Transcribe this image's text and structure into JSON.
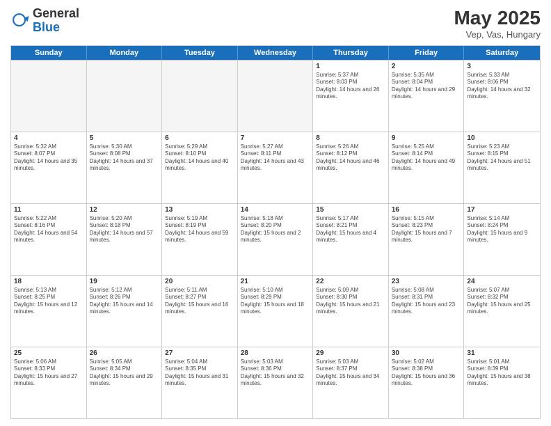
{
  "logo": {
    "general": "General",
    "blue": "Blue"
  },
  "header": {
    "title": "May 2025",
    "subtitle": "Vep, Vas, Hungary"
  },
  "days": [
    "Sunday",
    "Monday",
    "Tuesday",
    "Wednesday",
    "Thursday",
    "Friday",
    "Saturday"
  ],
  "rows": [
    [
      {
        "day": "",
        "empty": true
      },
      {
        "day": "",
        "empty": true
      },
      {
        "day": "",
        "empty": true
      },
      {
        "day": "",
        "empty": true
      },
      {
        "day": "1",
        "sunrise": "5:37 AM",
        "sunset": "8:03 PM",
        "daylight": "14 hours and 26 minutes."
      },
      {
        "day": "2",
        "sunrise": "5:35 AM",
        "sunset": "8:04 PM",
        "daylight": "14 hours and 29 minutes."
      },
      {
        "day": "3",
        "sunrise": "5:33 AM",
        "sunset": "8:06 PM",
        "daylight": "14 hours and 32 minutes."
      }
    ],
    [
      {
        "day": "4",
        "sunrise": "5:32 AM",
        "sunset": "8:07 PM",
        "daylight": "14 hours and 35 minutes."
      },
      {
        "day": "5",
        "sunrise": "5:30 AM",
        "sunset": "8:08 PM",
        "daylight": "14 hours and 37 minutes."
      },
      {
        "day": "6",
        "sunrise": "5:29 AM",
        "sunset": "8:10 PM",
        "daylight": "14 hours and 40 minutes."
      },
      {
        "day": "7",
        "sunrise": "5:27 AM",
        "sunset": "8:11 PM",
        "daylight": "14 hours and 43 minutes."
      },
      {
        "day": "8",
        "sunrise": "5:26 AM",
        "sunset": "8:12 PM",
        "daylight": "14 hours and 46 minutes."
      },
      {
        "day": "9",
        "sunrise": "5:25 AM",
        "sunset": "8:14 PM",
        "daylight": "14 hours and 49 minutes."
      },
      {
        "day": "10",
        "sunrise": "5:23 AM",
        "sunset": "8:15 PM",
        "daylight": "14 hours and 51 minutes."
      }
    ],
    [
      {
        "day": "11",
        "sunrise": "5:22 AM",
        "sunset": "8:16 PM",
        "daylight": "14 hours and 54 minutes."
      },
      {
        "day": "12",
        "sunrise": "5:20 AM",
        "sunset": "8:18 PM",
        "daylight": "14 hours and 57 minutes."
      },
      {
        "day": "13",
        "sunrise": "5:19 AM",
        "sunset": "8:19 PM",
        "daylight": "14 hours and 59 minutes."
      },
      {
        "day": "14",
        "sunrise": "5:18 AM",
        "sunset": "8:20 PM",
        "daylight": "15 hours and 2 minutes."
      },
      {
        "day": "15",
        "sunrise": "5:17 AM",
        "sunset": "8:21 PM",
        "daylight": "15 hours and 4 minutes."
      },
      {
        "day": "16",
        "sunrise": "5:15 AM",
        "sunset": "8:23 PM",
        "daylight": "15 hours and 7 minutes."
      },
      {
        "day": "17",
        "sunrise": "5:14 AM",
        "sunset": "8:24 PM",
        "daylight": "15 hours and 9 minutes."
      }
    ],
    [
      {
        "day": "18",
        "sunrise": "5:13 AM",
        "sunset": "8:25 PM",
        "daylight": "15 hours and 12 minutes."
      },
      {
        "day": "19",
        "sunrise": "5:12 AM",
        "sunset": "8:26 PM",
        "daylight": "15 hours and 14 minutes."
      },
      {
        "day": "20",
        "sunrise": "5:11 AM",
        "sunset": "8:27 PM",
        "daylight": "15 hours and 16 minutes."
      },
      {
        "day": "21",
        "sunrise": "5:10 AM",
        "sunset": "8:29 PM",
        "daylight": "15 hours and 18 minutes."
      },
      {
        "day": "22",
        "sunrise": "5:09 AM",
        "sunset": "8:30 PM",
        "daylight": "15 hours and 21 minutes."
      },
      {
        "day": "23",
        "sunrise": "5:08 AM",
        "sunset": "8:31 PM",
        "daylight": "15 hours and 23 minutes."
      },
      {
        "day": "24",
        "sunrise": "5:07 AM",
        "sunset": "8:32 PM",
        "daylight": "15 hours and 25 minutes."
      }
    ],
    [
      {
        "day": "25",
        "sunrise": "5:06 AM",
        "sunset": "8:33 PM",
        "daylight": "15 hours and 27 minutes."
      },
      {
        "day": "26",
        "sunrise": "5:05 AM",
        "sunset": "8:34 PM",
        "daylight": "15 hours and 29 minutes."
      },
      {
        "day": "27",
        "sunrise": "5:04 AM",
        "sunset": "8:35 PM",
        "daylight": "15 hours and 31 minutes."
      },
      {
        "day": "28",
        "sunrise": "5:03 AM",
        "sunset": "8:36 PM",
        "daylight": "15 hours and 32 minutes."
      },
      {
        "day": "29",
        "sunrise": "5:03 AM",
        "sunset": "8:37 PM",
        "daylight": "15 hours and 34 minutes."
      },
      {
        "day": "30",
        "sunrise": "5:02 AM",
        "sunset": "8:38 PM",
        "daylight": "15 hours and 36 minutes."
      },
      {
        "day": "31",
        "sunrise": "5:01 AM",
        "sunset": "8:39 PM",
        "daylight": "15 hours and 38 minutes."
      }
    ]
  ]
}
